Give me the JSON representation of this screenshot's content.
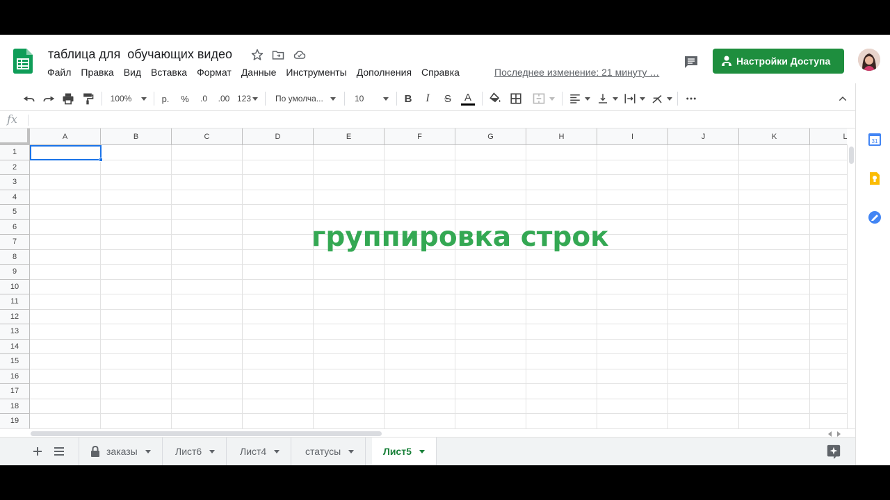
{
  "header": {
    "title": "таблица для  обучающих видео",
    "menu": [
      "Файл",
      "Правка",
      "Вид",
      "Вставка",
      "Формат",
      "Данные",
      "Инструменты",
      "Дополнения",
      "Справка"
    ],
    "last_edit": "Последнее изменение: 21 минуту …",
    "share_label": "Настройки Доступа",
    "colors": {
      "share": "#1e8e3e",
      "brand": "#0f9d58"
    }
  },
  "toolbar": {
    "zoom": "100%",
    "currency": "р.",
    "percent": "%",
    "decrease_decimals": ".0",
    "increase_decimals": ".00",
    "more_formats": "123",
    "font": "По умолча...",
    "font_size": "10",
    "icons": [
      "undo-icon",
      "redo-icon",
      "print-icon",
      "paint-format-icon",
      "bold-icon",
      "italic-icon",
      "strikethrough-icon",
      "text-color-icon",
      "fill-color-icon",
      "borders-icon",
      "merge-icon",
      "align-left-icon",
      "valign-bottom-icon",
      "wrap-icon",
      "rotate-icon",
      "more-icon",
      "collapse-icon"
    ]
  },
  "formula_bar": {
    "fx": "fx",
    "value": ""
  },
  "grid": {
    "columns": [
      "A",
      "B",
      "C",
      "D",
      "E",
      "F",
      "G",
      "H",
      "I",
      "J",
      "K",
      "L"
    ],
    "rows": [
      "1",
      "2",
      "3",
      "4",
      "5",
      "6",
      "7",
      "8",
      "9",
      "10",
      "11",
      "12",
      "13",
      "14",
      "15",
      "16",
      "17",
      "18",
      "19"
    ],
    "selected_cell": "A1"
  },
  "overlay": {
    "text": "группировка строк",
    "color": "#34a853"
  },
  "sheets": {
    "tabs": [
      {
        "label": "заказы",
        "locked": true,
        "active": false
      },
      {
        "label": "Лист6",
        "locked": false,
        "active": false
      },
      {
        "label": "Лист4",
        "locked": false,
        "active": false
      },
      {
        "label": "статусы",
        "locked": false,
        "active": false
      },
      {
        "label": "Лист5",
        "locked": false,
        "active": true
      }
    ]
  },
  "side_panel": {
    "icons": [
      "calendar-icon",
      "keep-icon",
      "tasks-icon",
      "expand-panel-icon"
    ]
  }
}
